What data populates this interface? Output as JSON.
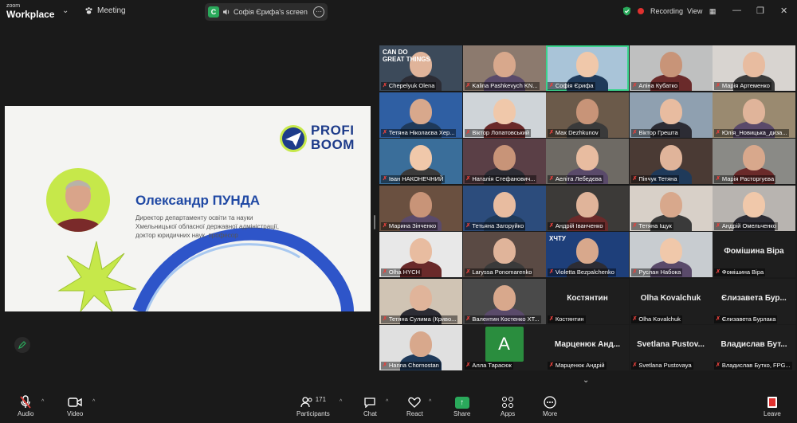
{
  "app": {
    "brand_small": "zoom",
    "brand": "Workplace",
    "meeting_label": "Meeting"
  },
  "share_indicator": {
    "badge": "C",
    "label": "Софія Єрифа's screen",
    "menu_icon": "more-icon"
  },
  "status": {
    "recording_label": "Recording",
    "view_label": "View"
  },
  "slide": {
    "logo_line1": "PROFI",
    "logo_line2": "BOOM",
    "speaker_name": "Олександр ПУНДА",
    "speaker_role": [
      "Директор департаменту освіти та науки",
      "Хмельницької обласної державної адміністрації,",
      "доктор юридичних наук, професор"
    ],
    "colors": {
      "accent": "#2049a4",
      "lime": "#c6e84a",
      "ring": "#2e55c9"
    }
  },
  "gallery": {
    "rows": [
      [
        {
          "name": "Chepelyuk Olena",
          "kind": "video",
          "bg": "#3c4a5a",
          "overlay": "CAN DO GREAT THINGS"
        },
        {
          "name": "Kalina Pashkevych KN...",
          "kind": "video",
          "bg": "#8c7a6e"
        },
        {
          "name": "Софія Єрифа",
          "kind": "video",
          "bg": "#a9c4d8",
          "active": true
        },
        {
          "name": "Аліна Кубатко",
          "kind": "video",
          "bg": "#bfc0c0"
        },
        {
          "name": "Марія Артеменко",
          "kind": "video",
          "bg": "#d8d4d0"
        }
      ],
      [
        {
          "name": "Тетяна Ніколаєва Хер...",
          "kind": "video",
          "bg": "#2f5fa3"
        },
        {
          "name": "Віктор Лопатовський",
          "kind": "video",
          "bg": "#cfd4d8"
        },
        {
          "name": "Max Dezhkunov",
          "kind": "video",
          "bg": "#6b5a4a"
        },
        {
          "name": "Віктор Грешта",
          "kind": "video",
          "bg": "#8fa0b0"
        },
        {
          "name": "Юлія_Новицька_диза...",
          "kind": "video",
          "bg": "#9a8a70"
        }
      ],
      [
        {
          "name": "Іван НАКОНЕЧНИЙ",
          "kind": "video",
          "bg": "#3a6e9a"
        },
        {
          "name": "Наталія Стефанович...",
          "kind": "video",
          "bg": "#5a3f46"
        },
        {
          "name": "Аеліта Лебедєва",
          "kind": "video",
          "bg": "#6e6a64"
        },
        {
          "name": "Пінчук Тетяна",
          "kind": "video",
          "bg": "#4a3a34"
        },
        {
          "name": "Марія Расторгуєва",
          "kind": "video",
          "bg": "#8a8a86"
        }
      ],
      [
        {
          "name": "Марина Зінченко",
          "kind": "video",
          "bg": "#6a5040"
        },
        {
          "name": "Тетьяна Загоруйко",
          "kind": "video",
          "bg": "#2c4c7c"
        },
        {
          "name": "Андрій Іванченко",
          "kind": "video",
          "bg": "#3c3a38"
        },
        {
          "name": "Тетяна Іщук",
          "kind": "video",
          "bg": "#d8d0c8"
        },
        {
          "name": "Андрій Омельченко",
          "kind": "video",
          "bg": "#b8b4b0"
        }
      ],
      [
        {
          "name": "Olha HYCH",
          "kind": "video",
          "bg": "#e8e8e8"
        },
        {
          "name": "Laryssa Ponomarenko",
          "kind": "video",
          "bg": "#5a4a44"
        },
        {
          "name": "Violetta Bezpalchenko",
          "kind": "video",
          "bg": "#1e3f7a",
          "overlay": "ХЧТУ"
        },
        {
          "name": "Руслан Набока",
          "kind": "video",
          "bg": "#c8ccd0"
        },
        {
          "name": "Фомішина Віра",
          "kind": "text",
          "bigname": "Фомішина Віра"
        }
      ],
      [
        {
          "name": "Тетяна Сулима (Криво...",
          "kind": "video",
          "bg": "#d0c4b4"
        },
        {
          "name": "Валентин Костенко ХТ...",
          "kind": "video",
          "bg": "#4a4a4a"
        },
        {
          "name": "Костянтин",
          "kind": "text",
          "bigname": "Костянтин"
        },
        {
          "name": "Olha Kovalchuk",
          "kind": "text",
          "bigname": "Olha Kovalchuk"
        },
        {
          "name": "Єлизавета Бурлака",
          "kind": "text",
          "bigname": "Єлизавета Бур..."
        }
      ],
      [
        {
          "name": "Hanna Chornostan",
          "kind": "video",
          "bg": "#e0e0e0"
        },
        {
          "name": "Алла Тарасюк",
          "kind": "avatar",
          "letter": "A"
        },
        {
          "name": "Марценюк Андрій",
          "kind": "text",
          "bigname": "Марценюк Анд..."
        },
        {
          "name": "Svetlana Pustovaya",
          "kind": "text",
          "bigname": "Svetlana Pustov..."
        },
        {
          "name": "Владислав Бутко, FPG...",
          "kind": "text",
          "bigname": "Владислав Бут..."
        }
      ]
    ]
  },
  "toolbar": {
    "audio": "Audio",
    "video": "Video",
    "participants": "Participants",
    "participants_count": "171",
    "chat": "Chat",
    "react": "React",
    "share": "Share",
    "apps": "Apps",
    "more": "More",
    "leave": "Leave"
  }
}
